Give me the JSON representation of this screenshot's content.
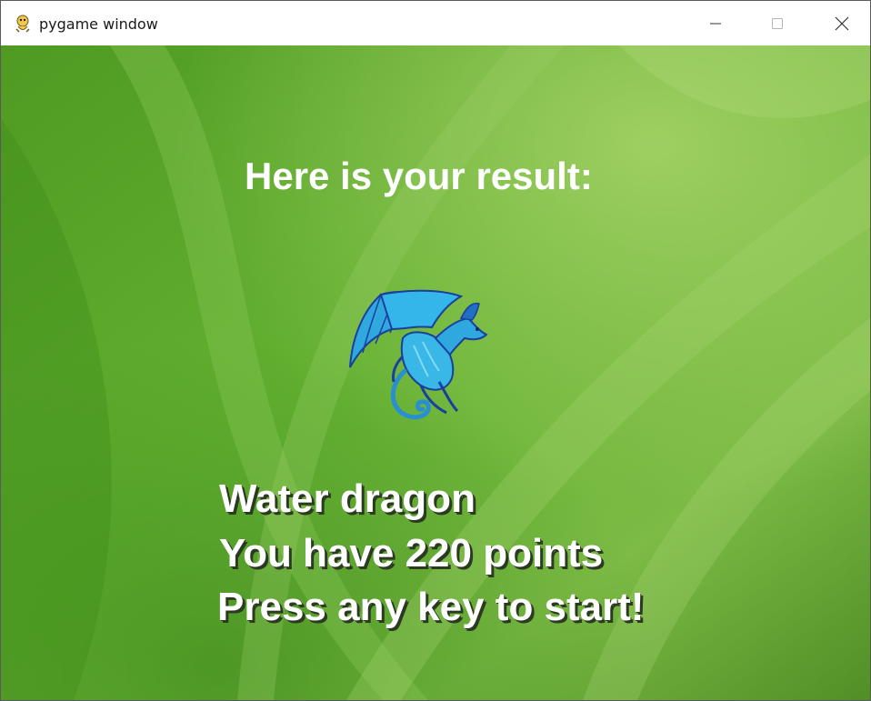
{
  "window": {
    "title": "pygame window",
    "app_icon": "pygame-snake-icon",
    "controls": {
      "minimize_icon": "minimize-icon",
      "maximize_icon": "maximize-icon",
      "close_icon": "close-icon"
    }
  },
  "game": {
    "headline": "Here is your result:",
    "result_name": "Water dragon",
    "points_text": "You have 220 points",
    "prompt": "Press any key to start!",
    "image": "water-dragon-icon",
    "background": "green-abstract-wallpaper"
  },
  "colors": {
    "background_green": "#5aa629",
    "text": "#ffffff",
    "dragon_primary": "#2fa8e0",
    "dragon_dark": "#1a3f9e"
  }
}
